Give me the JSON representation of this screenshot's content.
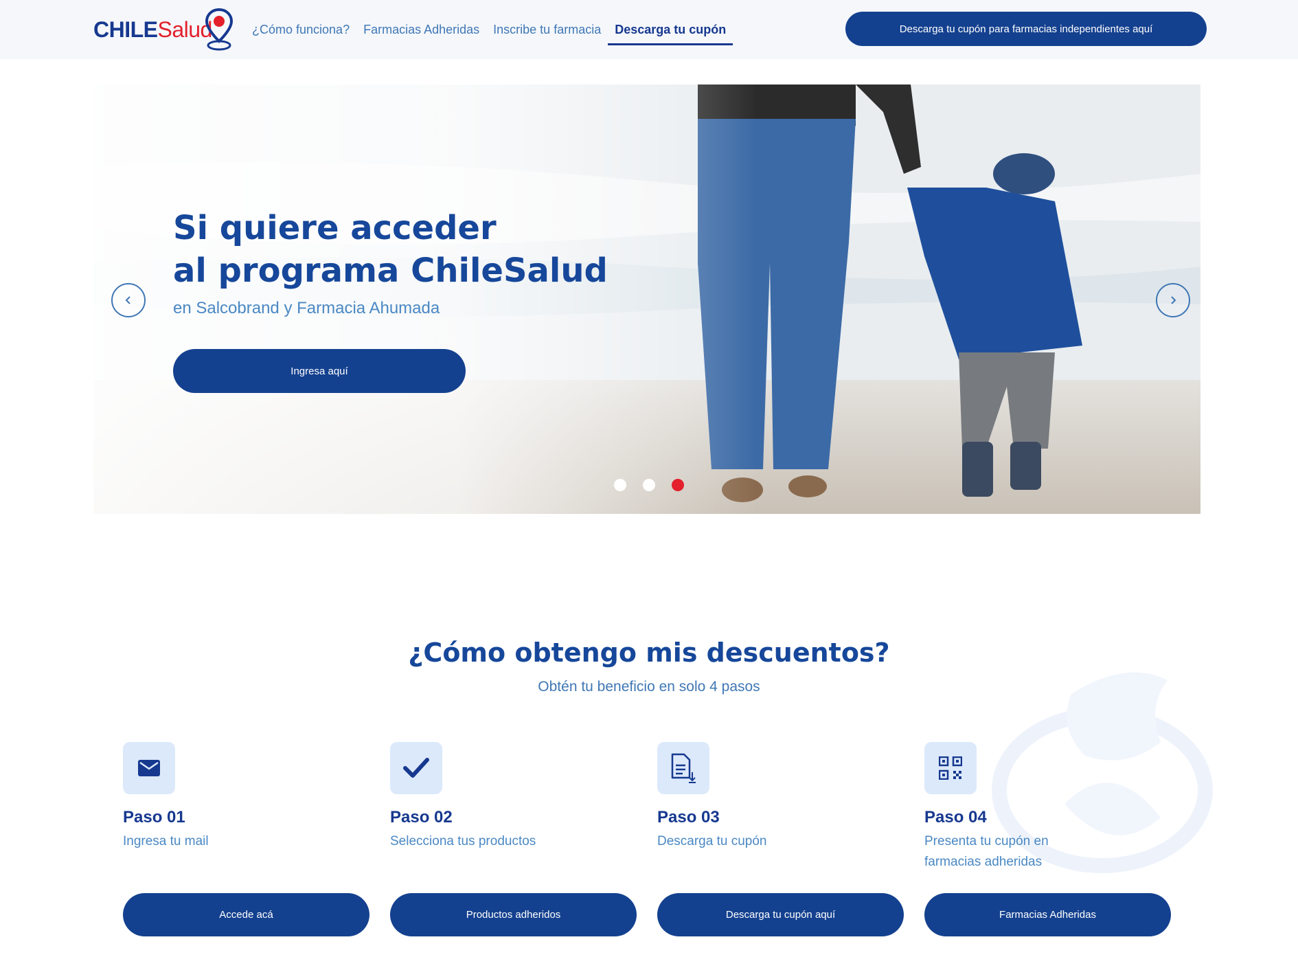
{
  "brand": {
    "logo_part1": "CHILE",
    "logo_part2": "Salud",
    "accent": "#16388f",
    "red": "#e3202b"
  },
  "nav": {
    "items": [
      {
        "label": "¿Cómo funciona?"
      },
      {
        "label": "Farmacias Adheridas"
      },
      {
        "label": "Inscribe tu farmacia"
      },
      {
        "label": "Descarga tu cupón",
        "active": true
      }
    ],
    "cta": "Descarga tu cupón para farmacias independientes aquí"
  },
  "hero": {
    "title_line1": "Si quiere acceder",
    "title_line2": "al programa ChileSalud",
    "subtitle": "en Salcobrand y Farmacia Ahumada",
    "button": "Ingresa aquí",
    "slides": 3,
    "active_slide": 3
  },
  "steps_section": {
    "title": "¿Cómo obtengo mis descuentos?",
    "subtitle": "Obtén tu beneficio en solo 4 pasos",
    "steps": [
      {
        "title": "Paso 01",
        "desc": "Ingresa tu mail",
        "icon": "mail-icon",
        "button": "Accede acá"
      },
      {
        "title": "Paso 02",
        "desc": "Selecciona tus productos",
        "icon": "check-icon",
        "button": "Productos adheridos"
      },
      {
        "title": "Paso 03",
        "desc": "Descarga tu cupón",
        "icon": "document-download-icon",
        "button": "Descarga tu cupón aquí"
      },
      {
        "title": "Paso 04",
        "desc": "Presenta tu cupón en farmacias adheridas",
        "icon": "qr-code-icon",
        "button": "Farmacias Adheridas"
      }
    ]
  }
}
